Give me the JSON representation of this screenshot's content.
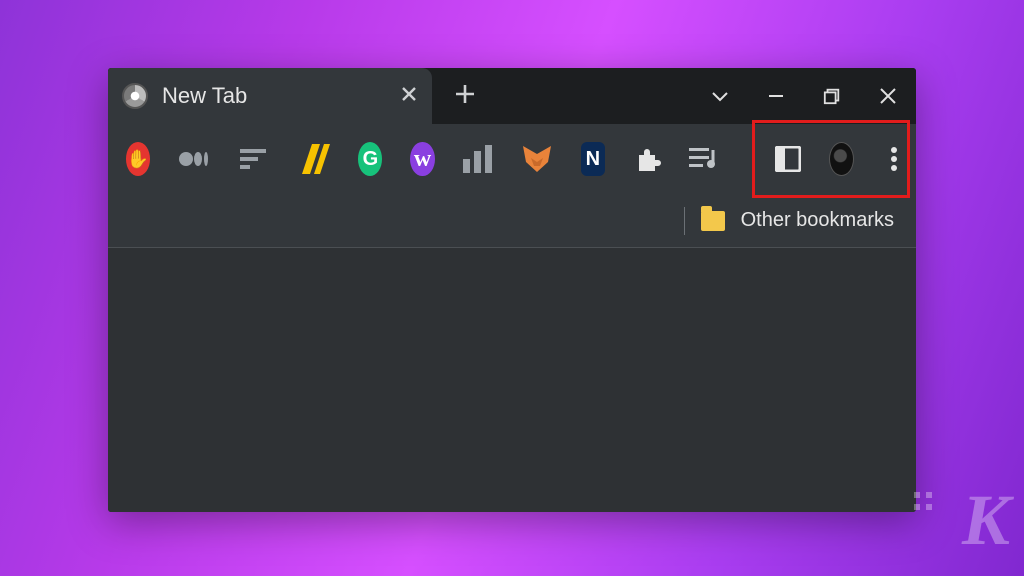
{
  "tab": {
    "title": "New Tab"
  },
  "bookmarks": {
    "other_label": "Other bookmarks"
  },
  "extensions": [
    {
      "name": "adblock",
      "glyph": "✋",
      "bg": "#e53530",
      "fg": "#ffffff",
      "shape": "circle"
    },
    {
      "name": "medium",
      "glyph": "",
      "shape": "ellipses"
    },
    {
      "name": "gtmetrix",
      "glyph": "",
      "shape": "bars-left"
    },
    {
      "name": "stripes",
      "glyph": "",
      "shape": "yellow-stripes"
    },
    {
      "name": "grammarly",
      "glyph": "G",
      "bg": "#17c27b",
      "fg": "#ffffff",
      "shape": "circle"
    },
    {
      "name": "writer",
      "glyph": "w",
      "bg": "#8a3fe0",
      "fg": "#ffffff",
      "shape": "circle-script"
    },
    {
      "name": "analytics",
      "glyph": "",
      "shape": "columns"
    },
    {
      "name": "metamask",
      "glyph": "",
      "shape": "fox"
    },
    {
      "name": "notion",
      "glyph": "N",
      "bg": "#0b2a55",
      "fg": "#ffffff",
      "shape": "square"
    },
    {
      "name": "extensions",
      "glyph": "",
      "shape": "puzzle"
    },
    {
      "name": "queue",
      "glyph": "",
      "shape": "music-list"
    }
  ],
  "toolbar_right": {
    "side_panel": "side-panel",
    "profile": "profile-avatar",
    "menu": "menu"
  },
  "watermark": "K"
}
